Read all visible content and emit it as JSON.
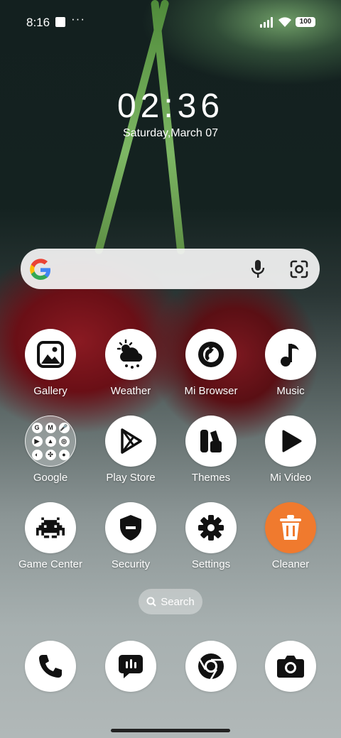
{
  "status": {
    "time": "8:16",
    "dots": "···",
    "battery": "100"
  },
  "lockscreen": {
    "clock": "02:36",
    "date": "Saturday,March 07"
  },
  "search_widget": {
    "logo_icon": "google-g-icon",
    "mic_icon": "mic-icon",
    "lens_icon": "lens-icon"
  },
  "apps": [
    {
      "label": "Gallery",
      "icon": "gallery-icon"
    },
    {
      "label": "Weather",
      "icon": "weather-icon"
    },
    {
      "label": "Mi Browser",
      "icon": "mi-browser-icon"
    },
    {
      "label": "Music",
      "icon": "music-note-icon"
    },
    {
      "label": "Google",
      "icon": "google-folder-icon"
    },
    {
      "label": "Play Store",
      "icon": "play-store-icon"
    },
    {
      "label": "Themes",
      "icon": "themes-icon"
    },
    {
      "label": "Mi Video",
      "icon": "play-icon"
    },
    {
      "label": "Game Center",
      "icon": "space-invader-icon"
    },
    {
      "label": "Security",
      "icon": "shield-icon"
    },
    {
      "label": "Settings",
      "icon": "gear-icon"
    },
    {
      "label": "Cleaner",
      "icon": "trash-icon"
    }
  ],
  "folder_minis": [
    "G",
    "M",
    "🎤",
    "▶",
    "▲",
    "◎",
    "◐",
    "✣",
    "●"
  ],
  "drawer_search": {
    "label": "Search"
  },
  "dock": [
    {
      "icon": "phone-icon"
    },
    {
      "icon": "messages-icon"
    },
    {
      "icon": "chrome-icon"
    },
    {
      "icon": "camera-icon"
    }
  ],
  "colors": {
    "cleaner": "#f07a2e",
    "icon_dark": "#111111"
  }
}
